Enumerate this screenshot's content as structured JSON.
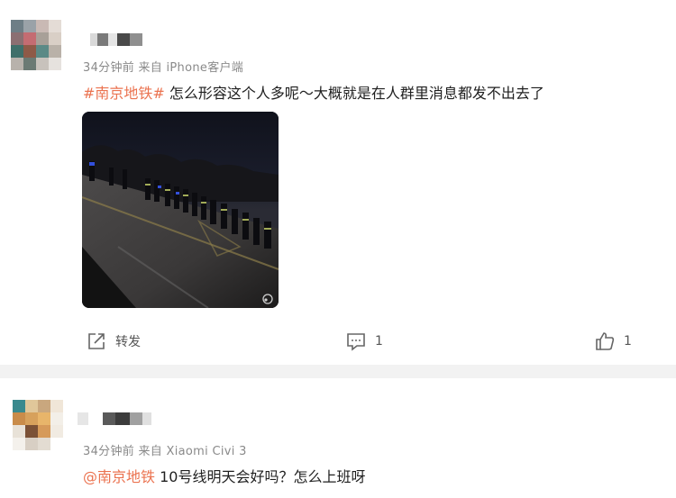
{
  "post1": {
    "meta": "34分钟前  来自 iPhone客户端",
    "hashtag": "#南京地铁#",
    "text": " 怎么形容这个人多呢～大概就是在人群里消息都发不出去了",
    "actions": {
      "repost_label": "转发",
      "comment_count": "1",
      "like_count": "1"
    }
  },
  "post2": {
    "meta": "34分钟前  来自 Xiaomi Civi 3",
    "mention": "@南京地铁",
    "text": " 10号线明天会好吗？怎么上班呀"
  },
  "colors": {
    "link": "#eb7350",
    "meta_gray": "#8a8a8a",
    "divider": "#f2f2f2"
  },
  "icons": [
    "repost-icon",
    "comment-icon",
    "like-icon",
    "watermark-icon"
  ]
}
